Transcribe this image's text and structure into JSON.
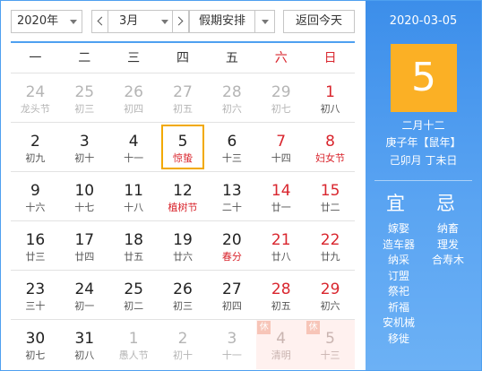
{
  "toolbar": {
    "year_value": "2020年",
    "month_value": "3月",
    "holiday_value": "假期安排",
    "today_label": "返回今天"
  },
  "weekdays": [
    "一",
    "二",
    "三",
    "四",
    "五",
    "六",
    "日"
  ],
  "days": [
    {
      "num": "24",
      "lunar": "龙头节",
      "other": true
    },
    {
      "num": "25",
      "lunar": "初三",
      "other": true
    },
    {
      "num": "26",
      "lunar": "初四",
      "other": true
    },
    {
      "num": "27",
      "lunar": "初五",
      "other": true
    },
    {
      "num": "28",
      "lunar": "初六",
      "other": true
    },
    {
      "num": "29",
      "lunar": "初七",
      "other": true
    },
    {
      "num": "1",
      "lunar": "初八",
      "weekend": true
    },
    {
      "num": "2",
      "lunar": "初九"
    },
    {
      "num": "3",
      "lunar": "初十"
    },
    {
      "num": "4",
      "lunar": "十一"
    },
    {
      "num": "5",
      "lunar": "惊蛰",
      "fest": true,
      "selected": true
    },
    {
      "num": "6",
      "lunar": "十三"
    },
    {
      "num": "7",
      "lunar": "十四",
      "weekend": true
    },
    {
      "num": "8",
      "lunar": "妇女节",
      "weekend": true,
      "fest": true
    },
    {
      "num": "9",
      "lunar": "十六"
    },
    {
      "num": "10",
      "lunar": "十七"
    },
    {
      "num": "11",
      "lunar": "十八"
    },
    {
      "num": "12",
      "lunar": "植树节",
      "fest": true
    },
    {
      "num": "13",
      "lunar": "二十"
    },
    {
      "num": "14",
      "lunar": "廿一",
      "weekend": true
    },
    {
      "num": "15",
      "lunar": "廿二",
      "weekend": true
    },
    {
      "num": "16",
      "lunar": "廿三"
    },
    {
      "num": "17",
      "lunar": "廿四"
    },
    {
      "num": "18",
      "lunar": "廿五"
    },
    {
      "num": "19",
      "lunar": "廿六"
    },
    {
      "num": "20",
      "lunar": "春分",
      "fest": true
    },
    {
      "num": "21",
      "lunar": "廿八",
      "weekend": true
    },
    {
      "num": "22",
      "lunar": "廿九",
      "weekend": true
    },
    {
      "num": "23",
      "lunar": "三十"
    },
    {
      "num": "24",
      "lunar": "初一"
    },
    {
      "num": "25",
      "lunar": "初二"
    },
    {
      "num": "26",
      "lunar": "初三"
    },
    {
      "num": "27",
      "lunar": "初四"
    },
    {
      "num": "28",
      "lunar": "初五",
      "weekend": true
    },
    {
      "num": "29",
      "lunar": "初六",
      "weekend": true
    },
    {
      "num": "30",
      "lunar": "初七"
    },
    {
      "num": "31",
      "lunar": "初八"
    },
    {
      "num": "1",
      "lunar": "愚人节",
      "other": true
    },
    {
      "num": "2",
      "lunar": "初十",
      "other": true
    },
    {
      "num": "3",
      "lunar": "十一",
      "other": true
    },
    {
      "num": "4",
      "lunar": "清明",
      "other": true,
      "rest": true,
      "badge": "休"
    },
    {
      "num": "5",
      "lunar": "十三",
      "other": true,
      "rest": true,
      "badge": "休"
    }
  ],
  "side": {
    "date": "2020-03-05",
    "big_day": "5",
    "lunar_date": "二月十二",
    "ganzhi_year": "庚子年【鼠年】",
    "ganzhi_month_day": "己卯月 丁未日",
    "yi_title": "宜",
    "ji_title": "忌",
    "yi": [
      "嫁娶",
      "造车器",
      "纳采",
      "订盟",
      "祭祀",
      "祈福",
      "安机械",
      "移徙"
    ],
    "ji": [
      "纳畜",
      "理发",
      "合寿木"
    ]
  },
  "colors": {
    "accent_blue": "#4ea0f0",
    "weekend_red": "#d9262e",
    "selected_border": "#f2a900",
    "big_day_bg": "#fbb025",
    "rest_bg": "#fff1ef"
  }
}
